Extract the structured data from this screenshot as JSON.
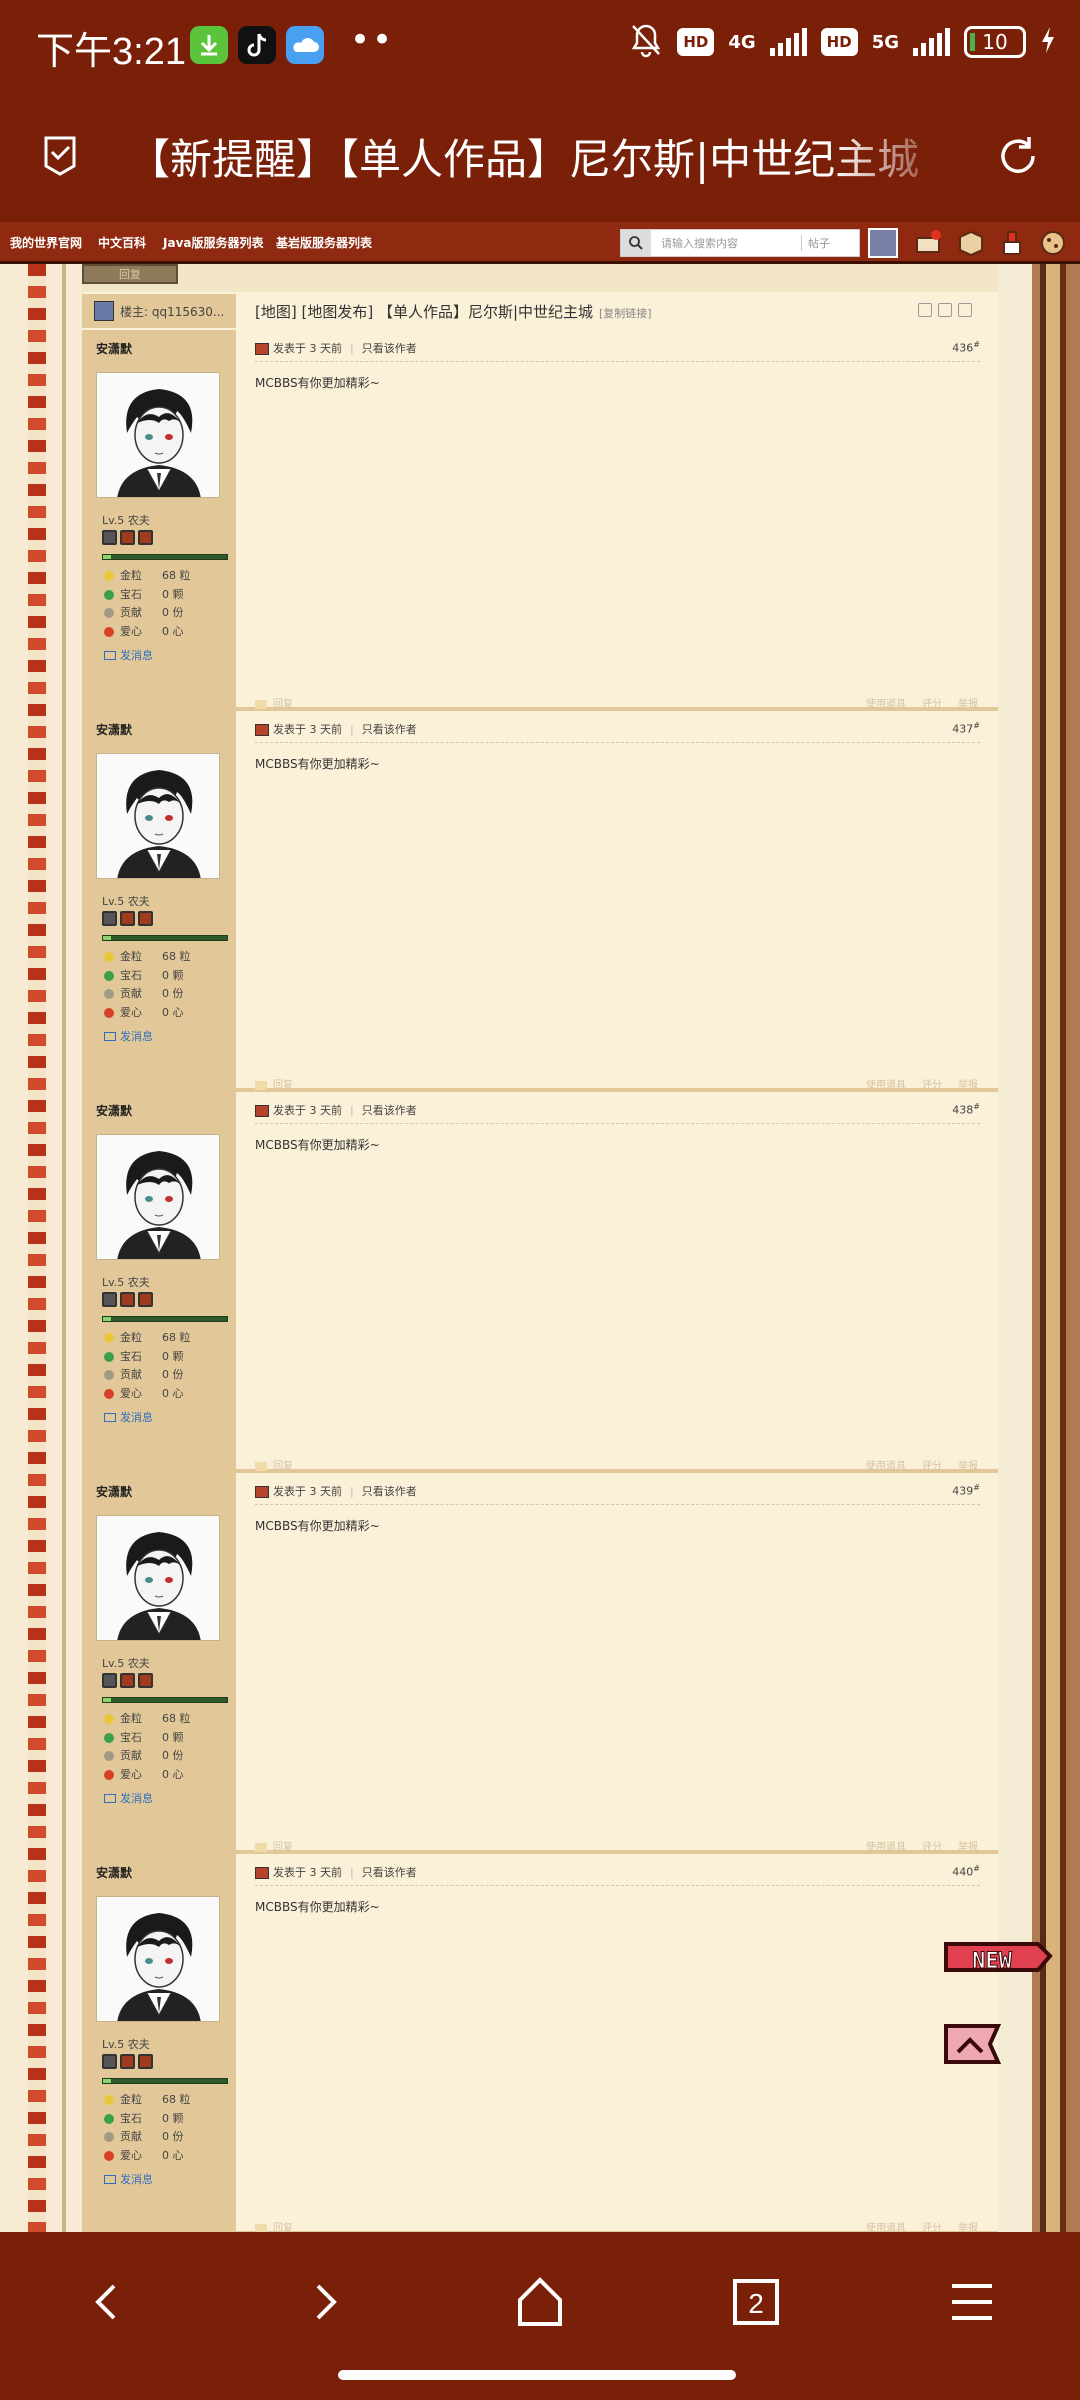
{
  "status_bar": {
    "time": "下午3:21",
    "network_4g": "4G",
    "network_5g": "5G",
    "hd1": "HD",
    "hd2": "HD",
    "battery": "10",
    "dots": "••"
  },
  "browser": {
    "title": "【新提醒】【单人作品】尼尔斯|中世纪主城",
    "tab_count": "2"
  },
  "site_nav": {
    "items": [
      "我的世界官网",
      "中文百科",
      "Java版服务器列表",
      "基岩版服务器列表"
    ],
    "search_placeholder": "请输入搜索内容",
    "search_scope": "帖子"
  },
  "thread": {
    "top_tab": "回复",
    "author_label": "楼主: qq115630...",
    "title": "[地图] [地图发布] 【单人作品】尼尔斯|中世纪主城",
    "copy_link": "[复制链接]"
  },
  "posts": [
    {
      "username": "安潇默",
      "level": "Lv.5 农夫",
      "stats": [
        {
          "label": "金粒",
          "value": "68 粒"
        },
        {
          "label": "宝石",
          "value": "0 颗"
        },
        {
          "label": "贡献",
          "value": "0 份"
        },
        {
          "label": "爱心",
          "value": "0 心"
        }
      ],
      "send_msg": "发消息",
      "posted": "发表于 3 天前",
      "only_author": "只看该作者",
      "floor": "436",
      "content": "MCBBS有你更加精彩~",
      "reply": "回复",
      "use_item": "使用道具",
      "rate": "评分",
      "report": "举报"
    },
    {
      "username": "安潇默",
      "level": "Lv.5 农夫",
      "stats": [
        {
          "label": "金粒",
          "value": "68 粒"
        },
        {
          "label": "宝石",
          "value": "0 颗"
        },
        {
          "label": "贡献",
          "value": "0 份"
        },
        {
          "label": "爱心",
          "value": "0 心"
        }
      ],
      "send_msg": "发消息",
      "posted": "发表于 3 天前",
      "only_author": "只看该作者",
      "floor": "437",
      "content": "MCBBS有你更加精彩~",
      "reply": "回复",
      "use_item": "使用道具",
      "rate": "评分",
      "report": "举报"
    },
    {
      "username": "安潇默",
      "level": "Lv.5 农夫",
      "stats": [
        {
          "label": "金粒",
          "value": "68 粒"
        },
        {
          "label": "宝石",
          "value": "0 颗"
        },
        {
          "label": "贡献",
          "value": "0 份"
        },
        {
          "label": "爱心",
          "value": "0 心"
        }
      ],
      "send_msg": "发消息",
      "posted": "发表于 3 天前",
      "only_author": "只看该作者",
      "floor": "438",
      "content": "MCBBS有你更加精彩~",
      "reply": "回复",
      "use_item": "使用道具",
      "rate": "评分",
      "report": "举报"
    },
    {
      "username": "安潇默",
      "level": "Lv.5 农夫",
      "stats": [
        {
          "label": "金粒",
          "value": "68 粒"
        },
        {
          "label": "宝石",
          "value": "0 颗"
        },
        {
          "label": "贡献",
          "value": "0 份"
        },
        {
          "label": "爱心",
          "value": "0 心"
        }
      ],
      "send_msg": "发消息",
      "posted": "发表于 3 天前",
      "only_author": "只看该作者",
      "floor": "439",
      "content": "MCBBS有你更加精彩~",
      "reply": "回复",
      "use_item": "使用道具",
      "rate": "评分",
      "report": "举报"
    },
    {
      "username": "安潇默",
      "level": "Lv.5 农夫",
      "stats": [
        {
          "label": "金粒",
          "value": "68 粒"
        },
        {
          "label": "宝石",
          "value": "0 颗"
        },
        {
          "label": "贡献",
          "value": "0 份"
        },
        {
          "label": "爱心",
          "value": "0 心"
        }
      ],
      "send_msg": "发消息",
      "posted": "发表于 3 天前",
      "only_author": "只看该作者",
      "floor": "440",
      "content": "MCBBS有你更加精彩~",
      "reply": "回复",
      "use_item": "使用道具",
      "rate": "评分",
      "report": "举报"
    }
  ],
  "floating": {
    "new_badge": "NEW"
  },
  "colors": {
    "brand": "#7a1f08",
    "nav": "#8f2a10",
    "post_bg": "#fbf0d8",
    "sidebar": "#e2c898"
  },
  "stat_colors": [
    "#e8c83a",
    "#3aa04a",
    "#a09a86",
    "#d8402a"
  ]
}
